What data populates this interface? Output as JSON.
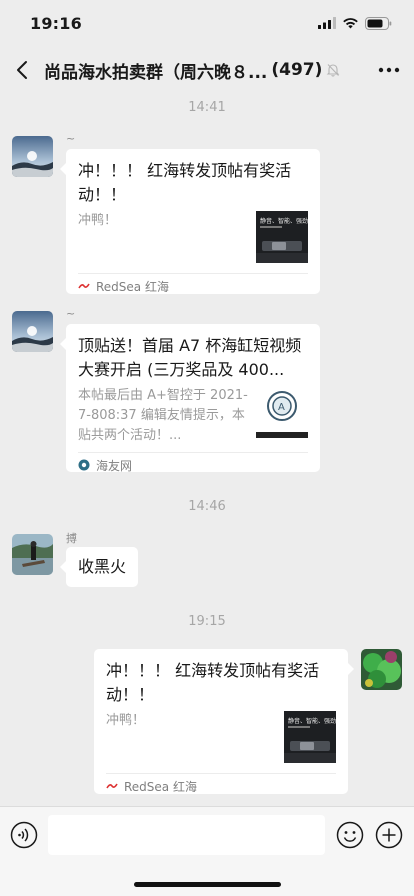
{
  "status": {
    "time": "19:16"
  },
  "header": {
    "title": "尚品海水拍卖群（周六晚８...",
    "member_count": "(497)"
  },
  "timestamps": [
    "14:41",
    "14:46",
    "19:15"
  ],
  "messages": [
    {
      "nick": "~",
      "title": "冲！！！ 红海转发顶帖有奖活动！！",
      "desc": "冲鸭！",
      "source": "RedSea 红海",
      "thumb_text": "静音、智能、强劲"
    },
    {
      "nick": "~",
      "title": "顶贴送！首届 A7 杯海缸短视频大赛开启 (三万奖品及 400...",
      "desc": "本帖最后由 A+智控于 2021-7-808:37 编辑友情提示，本贴共两个活动！...",
      "source": "海友网"
    },
    {
      "nick": "搏",
      "text": "收黑火"
    },
    {
      "title": "冲！！！ 红海转发顶帖有奖活动！！",
      "desc": "冲鸭！",
      "source": "RedSea 红海",
      "thumb_text": "静音、智能、强劲"
    }
  ],
  "colors": {
    "background": "#ededed",
    "bubble": "#ffffff",
    "timestamp": "#a6a6a6"
  }
}
